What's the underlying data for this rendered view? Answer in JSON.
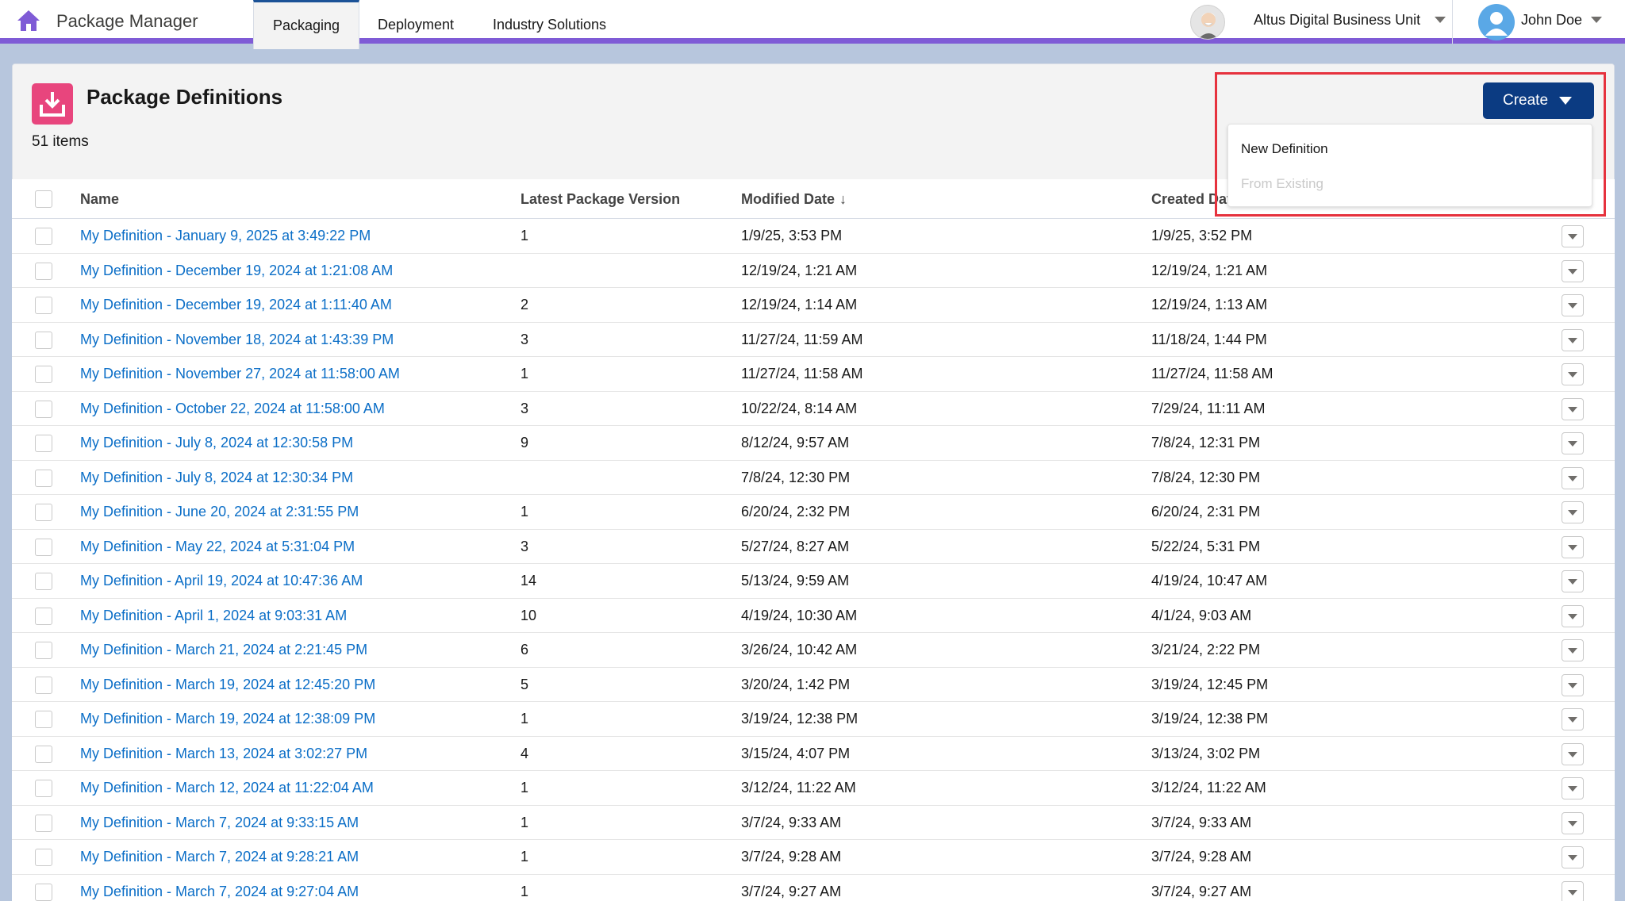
{
  "app": {
    "name": "Package Manager",
    "tabs": [
      {
        "label": "Packaging",
        "active": true
      },
      {
        "label": "Deployment",
        "active": false
      },
      {
        "label": "Industry Solutions",
        "active": false
      }
    ],
    "org_name": "Altus Digital Business Unit",
    "user_name": "John Doe",
    "accent_color": "#7f5bd6"
  },
  "page": {
    "title": "Package Definitions",
    "item_count": "51 items",
    "create_label": "Create",
    "create_menu": [
      "New Definition",
      "From Existing"
    ]
  },
  "table": {
    "columns": [
      "Name",
      "Latest Package Version",
      "Modified Date",
      "Created Date"
    ],
    "sort_indicator": "↓",
    "rows": [
      {
        "name": "My Definition - January 9, 2025 at 3:49:22 PM",
        "version": "1",
        "modified": "1/9/25, 3:53 PM",
        "created": "1/9/25, 3:52 PM"
      },
      {
        "name": "My Definition - December 19, 2024 at 1:21:08 AM",
        "version": "",
        "modified": "12/19/24, 1:21 AM",
        "created": "12/19/24, 1:21 AM"
      },
      {
        "name": "My Definition - December 19, 2024 at 1:11:40 AM",
        "version": "2",
        "modified": "12/19/24, 1:14 AM",
        "created": "12/19/24, 1:13 AM"
      },
      {
        "name": "My Definition - November 18, 2024 at 1:43:39 PM",
        "version": "3",
        "modified": "11/27/24, 11:59 AM",
        "created": "11/18/24, 1:44 PM"
      },
      {
        "name": "My Definition - November 27, 2024 at 11:58:00 AM",
        "version": "1",
        "modified": "11/27/24, 11:58 AM",
        "created": "11/27/24, 11:58 AM"
      },
      {
        "name": "My Definition - October 22, 2024 at 11:58:00 AM",
        "version": "3",
        "modified": "10/22/24, 8:14 AM",
        "created": "7/29/24, 11:11 AM"
      },
      {
        "name": "My Definition - July 8, 2024 at 12:30:58 PM",
        "version": "9",
        "modified": "8/12/24, 9:57 AM",
        "created": "7/8/24, 12:31 PM"
      },
      {
        "name": "My Definition - July 8, 2024 at 12:30:34 PM",
        "version": "",
        "modified": "7/8/24, 12:30 PM",
        "created": "7/8/24, 12:30 PM"
      },
      {
        "name": "My Definition - June 20, 2024 at 2:31:55 PM",
        "version": "1",
        "modified": "6/20/24, 2:32 PM",
        "created": "6/20/24, 2:31 PM"
      },
      {
        "name": "My Definition - May 22, 2024 at 5:31:04 PM",
        "version": "3",
        "modified": "5/27/24, 8:27 AM",
        "created": "5/22/24, 5:31 PM"
      },
      {
        "name": "My Definition - April 19, 2024 at 10:47:36 AM",
        "version": "14",
        "modified": "5/13/24, 9:59 AM",
        "created": "4/19/24, 10:47 AM"
      },
      {
        "name": "My Definition - April 1, 2024 at 9:03:31 AM",
        "version": "10",
        "modified": "4/19/24, 10:30 AM",
        "created": "4/1/24, 9:03 AM"
      },
      {
        "name": "My Definition - March 21, 2024 at 2:21:45 PM",
        "version": "6",
        "modified": "3/26/24, 10:42 AM",
        "created": "3/21/24, 2:22 PM"
      },
      {
        "name": "My Definition - March 19, 2024 at 12:45:20 PM",
        "version": "5",
        "modified": "3/20/24, 1:42 PM",
        "created": "3/19/24, 12:45 PM"
      },
      {
        "name": "My Definition - March 19, 2024 at 12:38:09 PM",
        "version": "1",
        "modified": "3/19/24, 12:38 PM",
        "created": "3/19/24, 12:38 PM"
      },
      {
        "name": "My Definition - March 13, 2024 at 3:02:27 PM",
        "version": "4",
        "modified": "3/15/24, 4:07 PM",
        "created": "3/13/24, 3:02 PM"
      },
      {
        "name": "My Definition - March 12, 2024 at 11:22:04 AM",
        "version": "1",
        "modified": "3/12/24, 11:22 AM",
        "created": "3/12/24, 11:22 AM"
      },
      {
        "name": "My Definition - March 7, 2024 at 9:33:15 AM",
        "version": "1",
        "modified": "3/7/24, 9:33 AM",
        "created": "3/7/24, 9:33 AM"
      },
      {
        "name": "My Definition - March 7, 2024 at 9:28:21 AM",
        "version": "1",
        "modified": "3/7/24, 9:28 AM",
        "created": "3/7/24, 9:28 AM"
      },
      {
        "name": "My Definition - March 7, 2024 at 9:27:04 AM",
        "version": "1",
        "modified": "3/7/24, 9:27 AM",
        "created": "3/7/24, 9:27 AM"
      }
    ]
  }
}
